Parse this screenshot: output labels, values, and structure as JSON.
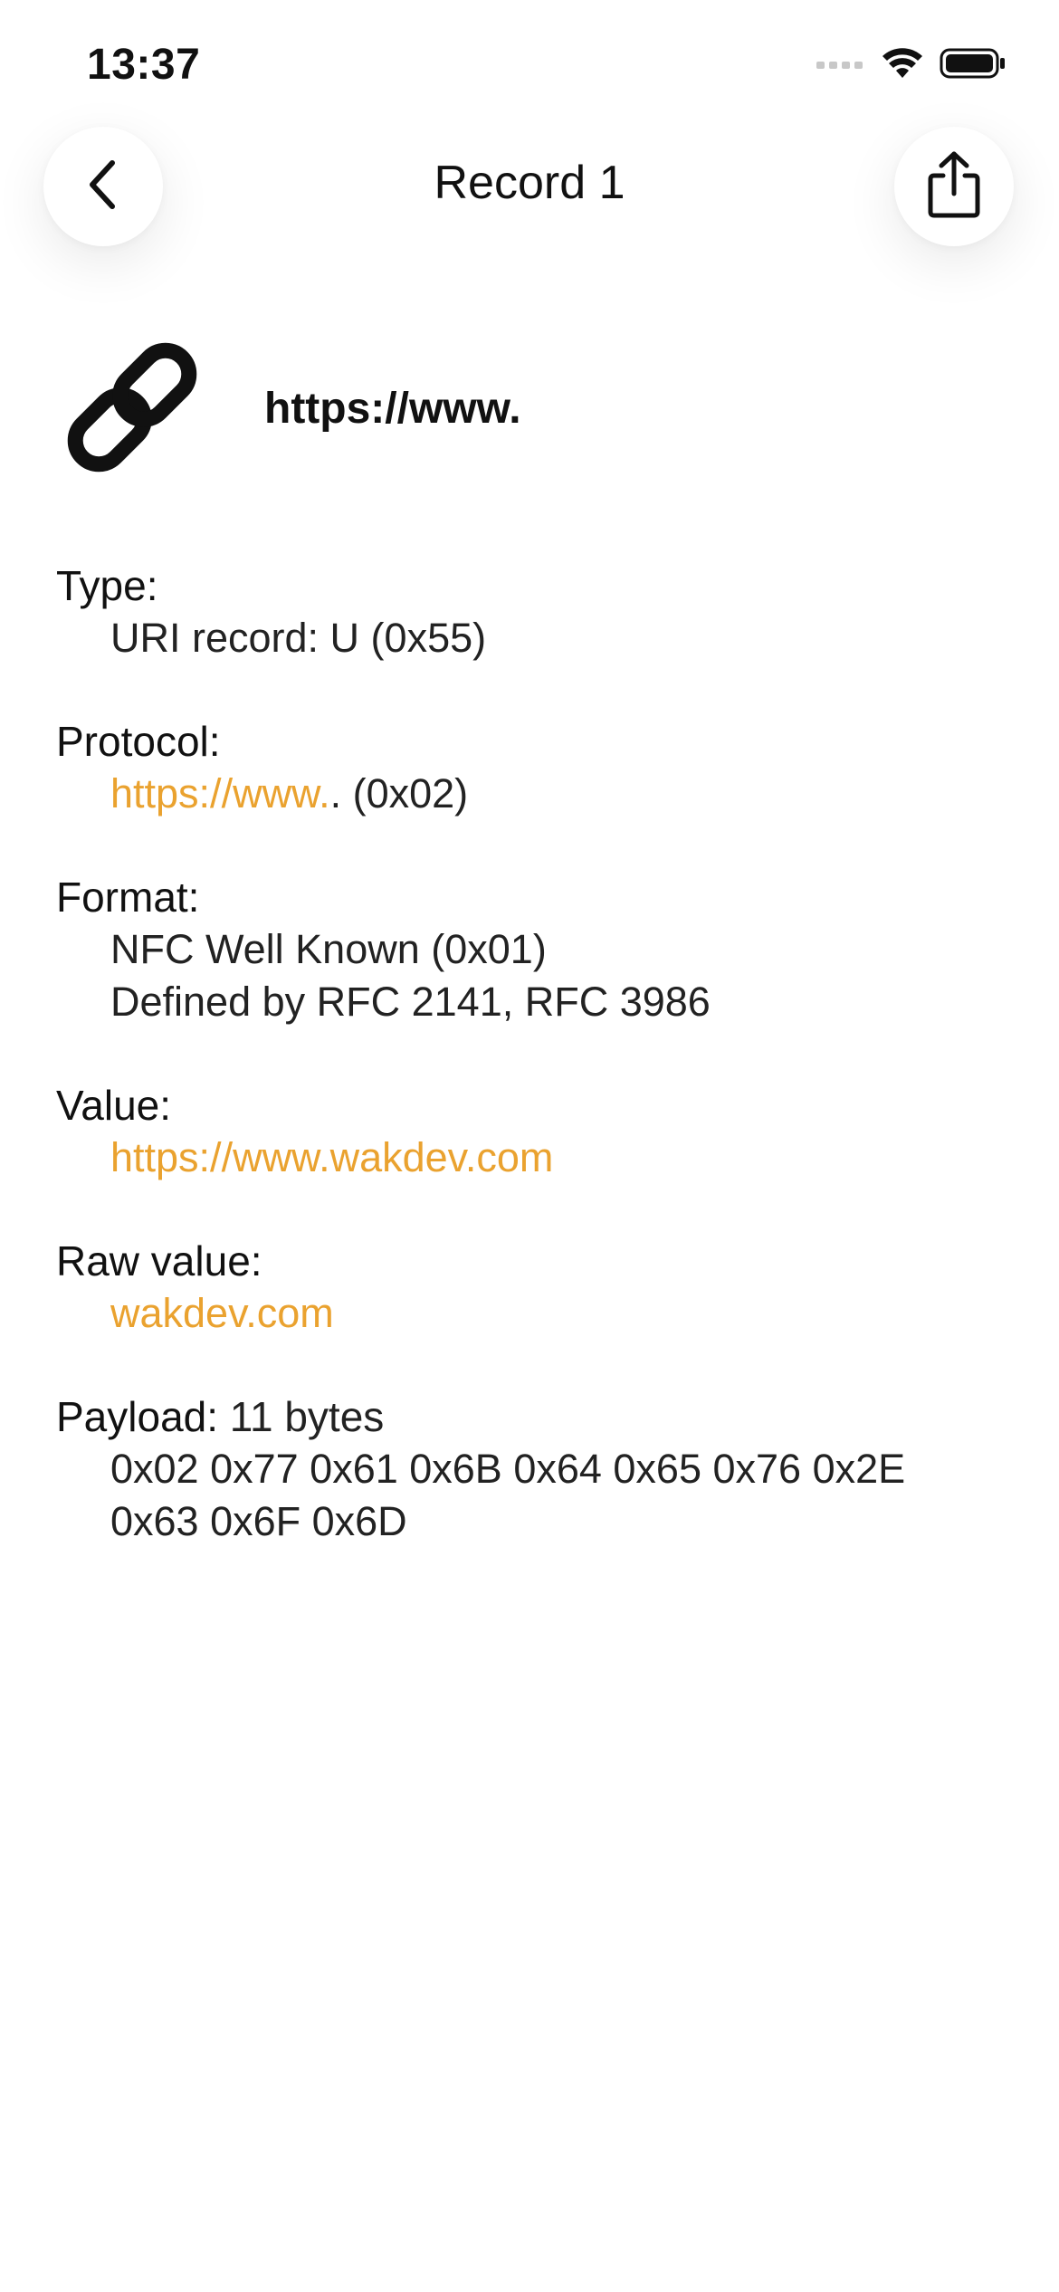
{
  "status_bar": {
    "time": "13:37",
    "icons": [
      "signal-icon",
      "wifi-icon",
      "battery-icon"
    ]
  },
  "nav": {
    "title": "Record 1",
    "back_icon": "chevron-left-icon",
    "share_icon": "share-icon"
  },
  "record": {
    "icon": "link-icon",
    "heading": "https://www."
  },
  "details": {
    "type": {
      "label": "Type:",
      "value": "URI record: U (0x55)"
    },
    "protocol": {
      "label": "Protocol:",
      "link": "https://www.",
      "suffix": ". (0x02)"
    },
    "format": {
      "label": "Format:",
      "line1": "NFC Well Known (0x01)",
      "line2": "Defined by RFC 2141, RFC 3986"
    },
    "value": {
      "label": "Value:",
      "link": "https://www.wakdev.com"
    },
    "raw_value": {
      "label": "Raw value:",
      "link": "wakdev.com"
    },
    "payload": {
      "label": "Payload:",
      "size": "11 bytes",
      "line1": "0x02 0x77 0x61 0x6B 0x64 0x65 0x76 0x2E",
      "line2": "0x63 0x6F 0x6D"
    }
  },
  "colors": {
    "accent": "#eaa22f",
    "text": "#111111",
    "background": "#ffffff"
  }
}
